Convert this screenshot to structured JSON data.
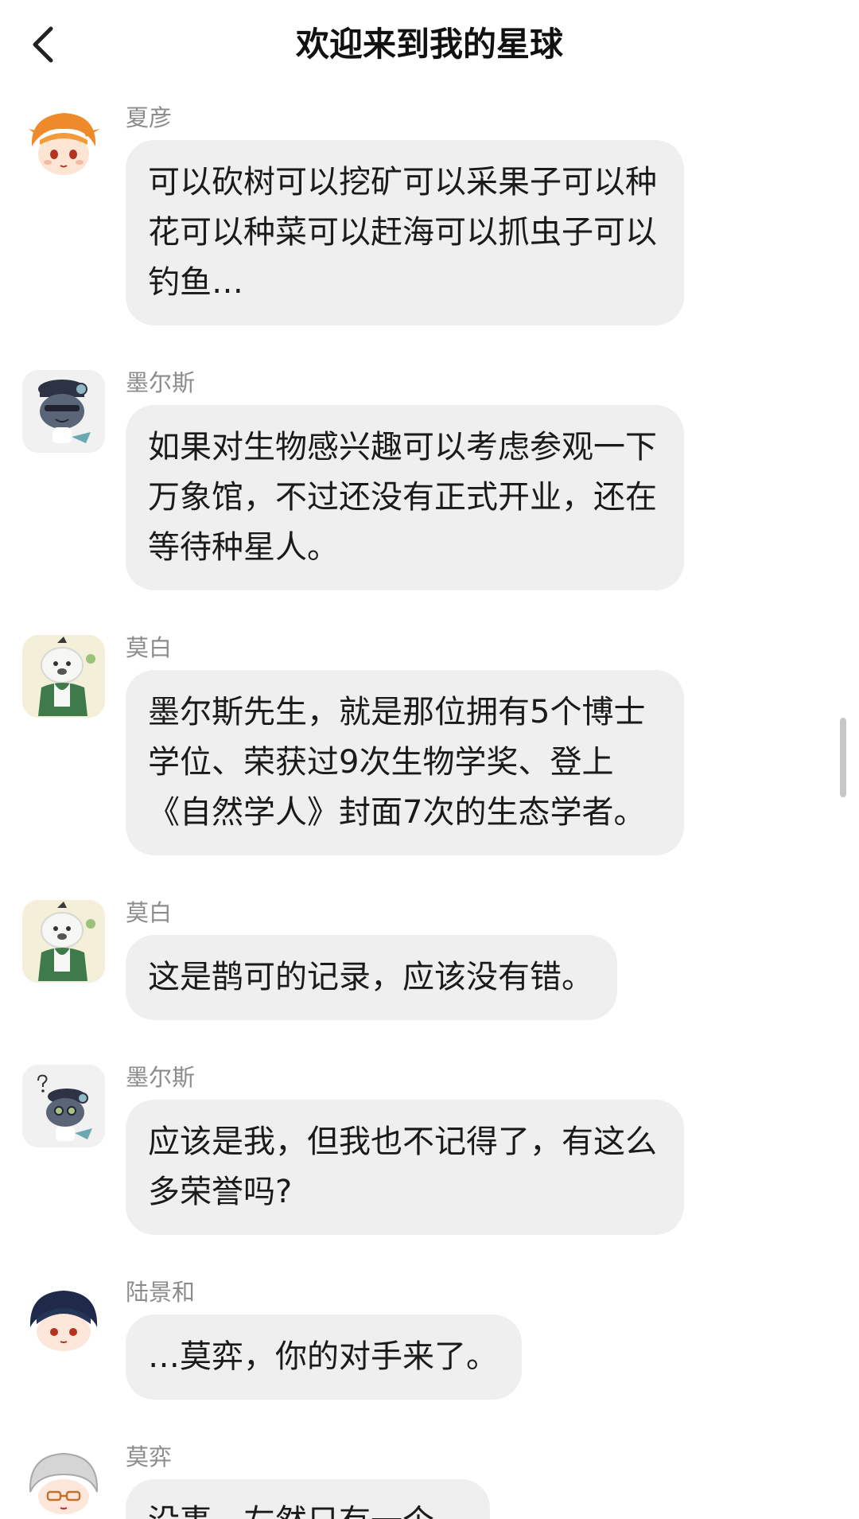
{
  "header": {
    "title": "欢迎来到我的星球",
    "back_icon": "chevron-left-icon"
  },
  "messages": [
    {
      "sender": "夏彦",
      "text": "可以砍树可以挖矿可以采果子可以种花可以种菜可以赶海可以抓虫子可以钓鱼…",
      "avatar": "orange-hair-avatar"
    },
    {
      "sender": "墨尔斯",
      "text": "如果对生物感兴趣可以考虑参观一下万象馆，不过还没有正式开业，还在等待种星人。",
      "avatar": "sea-creature-avatar"
    },
    {
      "sender": "莫白",
      "text": "墨尔斯先生，就是那位拥有5个博士学位、荣获过9次生物学奖、登上《自然学人》封面7次的生态学者。",
      "avatar": "white-bear-avatar"
    },
    {
      "sender": "莫白",
      "text": "这是鹊可的记录，应该没有错。",
      "avatar": "white-bear-avatar"
    },
    {
      "sender": "墨尔斯",
      "text": "应该是我，但我也不记得了，有这么多荣誉吗?",
      "avatar": "confused-sea-creature-avatar"
    },
    {
      "sender": "陆景和",
      "text": "…莫弈，你的对手来了。",
      "avatar": "dark-hair-avatar"
    },
    {
      "sender": "莫弈",
      "text": "没事，左然只有一个。",
      "avatar": "silver-hair-glasses-avatar"
    }
  ],
  "colors": {
    "bubble": "#efefef",
    "sender_name": "#8c8c8c",
    "title": "#111111"
  }
}
